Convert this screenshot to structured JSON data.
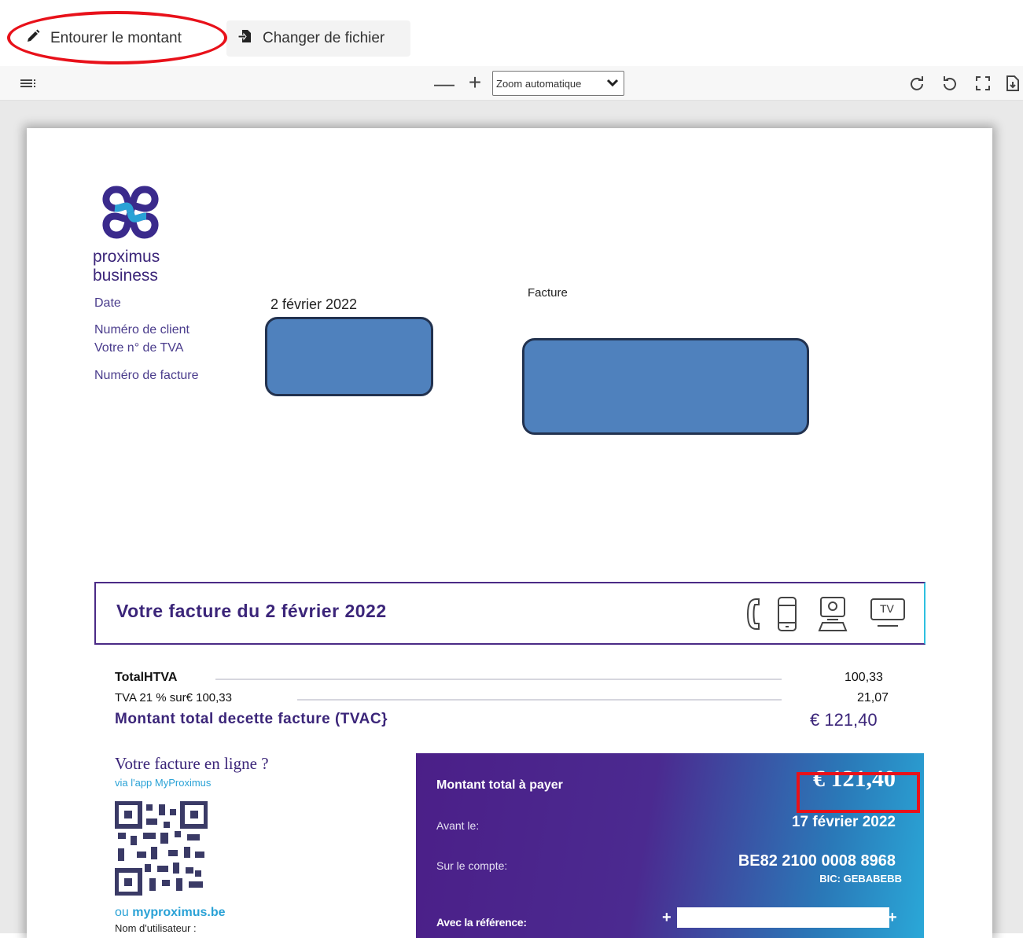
{
  "toolbar": {
    "circle_amount_label": "Entourer le montant",
    "change_file_label": "Changer de fichier"
  },
  "viewer": {
    "zoom_out": "—",
    "zoom_in": "+",
    "zoom_value": "Zoom automatique",
    "icons": [
      "menu-icon",
      "rotate-cw-icon",
      "rotate-ccw-icon",
      "fullscreen-icon",
      "download-icon"
    ]
  },
  "invoice": {
    "brand_line1": "proximus",
    "brand_line2": "business",
    "date_label": "Date",
    "date_value": "2 février 2022",
    "client_label": "Numéro de client",
    "vat_label": "Votre n° de TVA",
    "invoice_no_label": "Numéro de facture",
    "facture_label": "Facture",
    "summary_title": "Votre facture du 2 février 2022",
    "summary_icons": [
      "phone-icon",
      "mobile-icon",
      "computer-icon",
      "tv-icon"
    ],
    "tv_text": "TV",
    "lines": [
      {
        "label": "TotalHTVA",
        "value": "100,33"
      },
      {
        "label": "TVA 21 % sur€ 100,33",
        "value": "21,07"
      }
    ],
    "total_label": "Montant total decette facture (TVAC}",
    "total_value": "€ 121,40",
    "online_title": "Votre facture en ligne ?",
    "online_sub": "via l'app MyProximus",
    "or_prefix": "ou ",
    "site": "myproximus.be",
    "username_label": "Nom d'utilisateur :",
    "pay": {
      "total_label": "Montant total à payer",
      "total_value": "€ 121,40",
      "before_label": "Avant le:",
      "before_value": "17 février 2022",
      "account_label": "Sur le compte:",
      "account_value": "BE82 2100 0008 8968",
      "bic": "BIC: GEBABEBB",
      "ref_label": "Avec la référence:",
      "ref_plus_left": "+",
      "ref_plus_right": "+"
    }
  },
  "colors": {
    "accent_red": "#e8111a",
    "proximus_purple": "#4b2a86",
    "redaction_blue": "#4f81bd"
  }
}
